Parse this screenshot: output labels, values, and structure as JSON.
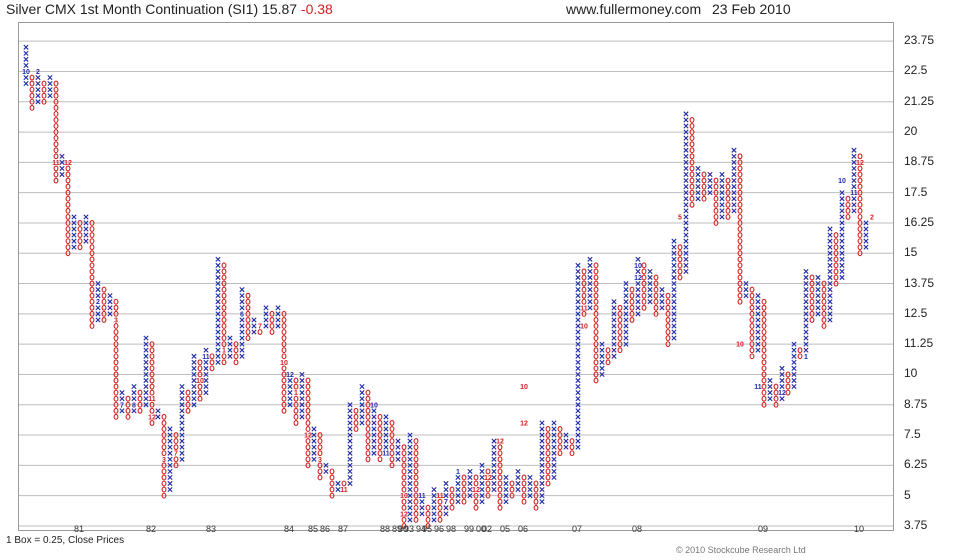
{
  "header": {
    "title": "Silver CMX 1st Month Continuation (SI1) 15.87",
    "change": "-0.38",
    "website": "www.fullermoney.com",
    "date": "23 Feb 2010"
  },
  "footer": {
    "box_note": "1 Box = 0.25, Close Prices",
    "copyright": "© 2010 Stockcube Research Ltd"
  },
  "colors": {
    "x_column": "#1e2aa8",
    "o_column": "#d42020",
    "grid": "#bdbdbd"
  },
  "chart_data": {
    "type": "point-and-figure",
    "title": "Silver CMX 1st Month Continuation (SI1) 15.87 -0.38",
    "box_size": 0.25,
    "price_basis": "Close Prices",
    "ylim": [
      3.5,
      24.5
    ],
    "y_ticks": [
      3.75,
      5,
      6.25,
      7.5,
      8.75,
      10,
      11.25,
      12.5,
      13.75,
      15,
      16.25,
      17.5,
      18.75,
      20,
      21.25,
      22.5,
      23.75
    ],
    "y_tick_labels": [
      "3.75",
      "5",
      "6.25",
      "7.5",
      "8.75",
      "10",
      "11.25",
      "12.5",
      "13.75",
      "15",
      "16.25",
      "17.5",
      "18.75",
      "20",
      "21.25",
      "22.5",
      "23.75"
    ],
    "grid": true,
    "x_tick_labels": [
      {
        "label": "81",
        "col": 9
      },
      {
        "label": "82",
        "col": 21
      },
      {
        "label": "83",
        "col": 31
      },
      {
        "label": "84",
        "col": 44
      },
      {
        "label": "85",
        "col": 48
      },
      {
        "label": "86",
        "col": 50
      },
      {
        "label": "87",
        "col": 53
      },
      {
        "label": "88",
        "col": 60
      },
      {
        "label": "89",
        "col": 62
      },
      {
        "label": "90",
        "col": 63
      },
      {
        "label": "93",
        "col": 64
      },
      {
        "label": "94",
        "col": 66
      },
      {
        "label": "95",
        "col": 67
      },
      {
        "label": "96",
        "col": 69
      },
      {
        "label": "98",
        "col": 71
      },
      {
        "label": "99",
        "col": 74
      },
      {
        "label": "00",
        "col": 76
      },
      {
        "label": "02",
        "col": 77
      },
      {
        "label": "05",
        "col": 80
      },
      {
        "label": "06",
        "col": 83
      },
      {
        "label": "07",
        "col": 92
      },
      {
        "label": "08",
        "col": 102
      },
      {
        "label": "09",
        "col": 123
      },
      {
        "label": "10",
        "col": 139
      }
    ],
    "columns": [
      {
        "type": "X",
        "low": 22.0,
        "high": 23.5
      },
      {
        "type": "O",
        "low": 21.0,
        "high": 22.25
      },
      {
        "type": "X",
        "low": 21.25,
        "high": 22.25
      },
      {
        "type": "O",
        "low": 21.25,
        "high": 22.0
      },
      {
        "type": "X",
        "low": 21.5,
        "high": 22.25
      },
      {
        "type": "O",
        "low": 18.0,
        "high": 22.0
      },
      {
        "type": "X",
        "low": 18.25,
        "high": 19.0
      },
      {
        "type": "O",
        "low": 15.0,
        "high": 18.75
      },
      {
        "type": "X",
        "low": 15.25,
        "high": 16.5
      },
      {
        "type": "O",
        "low": 15.25,
        "high": 16.25
      },
      {
        "type": "X",
        "low": 15.5,
        "high": 16.5
      },
      {
        "type": "O",
        "low": 12.0,
        "high": 16.25
      },
      {
        "type": "X",
        "low": 12.25,
        "high": 13.75
      },
      {
        "type": "O",
        "low": 12.25,
        "high": 13.5
      },
      {
        "type": "X",
        "low": 12.5,
        "high": 13.25
      },
      {
        "type": "O",
        "low": 8.25,
        "high": 13.0
      },
      {
        "type": "X",
        "low": 8.5,
        "high": 9.25
      },
      {
        "type": "O",
        "low": 8.25,
        "high": 9.0
      },
      {
        "type": "X",
        "low": 8.5,
        "high": 9.5
      },
      {
        "type": "O",
        "low": 8.5,
        "high": 9.25
      },
      {
        "type": "X",
        "low": 8.75,
        "high": 11.5
      },
      {
        "type": "O",
        "low": 8.0,
        "high": 11.25
      },
      {
        "type": "X",
        "low": 8.25,
        "high": 8.5
      },
      {
        "type": "O",
        "low": 5.0,
        "high": 8.25
      },
      {
        "type": "X",
        "low": 5.25,
        "high": 7.75
      },
      {
        "type": "O",
        "low": 6.25,
        "high": 7.5
      },
      {
        "type": "X",
        "low": 6.5,
        "high": 9.5
      },
      {
        "type": "O",
        "low": 8.5,
        "high": 9.25
      },
      {
        "type": "X",
        "low": 8.75,
        "high": 10.75
      },
      {
        "type": "O",
        "low": 9.0,
        "high": 10.5
      },
      {
        "type": "X",
        "low": 9.25,
        "high": 11.0
      },
      {
        "type": "O",
        "low": 10.25,
        "high": 10.75
      },
      {
        "type": "X",
        "low": 10.5,
        "high": 14.75
      },
      {
        "type": "O",
        "low": 10.5,
        "high": 14.5
      },
      {
        "type": "X",
        "low": 10.75,
        "high": 11.5
      },
      {
        "type": "O",
        "low": 10.5,
        "high": 11.25
      },
      {
        "type": "X",
        "low": 10.75,
        "high": 13.5
      },
      {
        "type": "O",
        "low": 11.5,
        "high": 13.25
      },
      {
        "type": "X",
        "low": 11.75,
        "high": 12.25
      },
      {
        "type": "O",
        "low": 11.75,
        "high": 12.0
      },
      {
        "type": "X",
        "low": 12.0,
        "high": 12.75
      },
      {
        "type": "O",
        "low": 11.75,
        "high": 12.5
      },
      {
        "type": "X",
        "low": 12.0,
        "high": 12.75
      },
      {
        "type": "O",
        "low": 8.5,
        "high": 12.5
      },
      {
        "type": "X",
        "low": 8.75,
        "high": 10.0
      },
      {
        "type": "O",
        "low": 8.0,
        "high": 9.75
      },
      {
        "type": "X",
        "low": 8.25,
        "high": 10.0
      },
      {
        "type": "O",
        "low": 6.25,
        "high": 9.75
      },
      {
        "type": "X",
        "low": 6.5,
        "high": 7.75
      },
      {
        "type": "O",
        "low": 5.75,
        "high": 7.5
      },
      {
        "type": "X",
        "low": 6.0,
        "high": 6.25
      },
      {
        "type": "O",
        "low": 5.0,
        "high": 6.0
      },
      {
        "type": "X",
        "low": 5.25,
        "high": 5.5
      },
      {
        "type": "O",
        "low": 5.25,
        "high": 5.5
      },
      {
        "type": "X",
        "low": 5.5,
        "high": 8.75
      },
      {
        "type": "O",
        "low": 7.75,
        "high": 8.5
      },
      {
        "type": "X",
        "low": 8.0,
        "high": 9.5
      },
      {
        "type": "O",
        "low": 6.5,
        "high": 9.25
      },
      {
        "type": "X",
        "low": 6.75,
        "high": 8.5
      },
      {
        "type": "O",
        "low": 6.5,
        "high": 8.25
      },
      {
        "type": "X",
        "low": 6.75,
        "high": 8.25
      },
      {
        "type": "O",
        "low": 6.25,
        "high": 8.0
      },
      {
        "type": "X",
        "low": 6.5,
        "high": 7.25
      },
      {
        "type": "O",
        "low": 3.75,
        "high": 7.0
      },
      {
        "type": "X",
        "low": 4.0,
        "high": 7.5
      },
      {
        "type": "O",
        "low": 4.0,
        "high": 7.25
      },
      {
        "type": "X",
        "low": 4.25,
        "high": 4.75
      },
      {
        "type": "O",
        "low": 3.75,
        "high": 4.5
      },
      {
        "type": "X",
        "low": 4.0,
        "high": 5.25
      },
      {
        "type": "O",
        "low": 4.0,
        "high": 5.0
      },
      {
        "type": "X",
        "low": 4.25,
        "high": 5.5
      },
      {
        "type": "O",
        "low": 4.5,
        "high": 5.25
      },
      {
        "type": "X",
        "low": 4.75,
        "high": 6.0
      },
      {
        "type": "O",
        "low": 4.75,
        "high": 5.75
      },
      {
        "type": "X",
        "low": 5.0,
        "high": 6.0
      },
      {
        "type": "O",
        "low": 4.5,
        "high": 5.75
      },
      {
        "type": "X",
        "low": 4.75,
        "high": 6.25
      },
      {
        "type": "O",
        "low": 5.0,
        "high": 6.0
      },
      {
        "type": "X",
        "low": 5.25,
        "high": 7.25
      },
      {
        "type": "O",
        "low": 4.5,
        "high": 7.0
      },
      {
        "type": "X",
        "low": 4.75,
        "high": 5.75
      },
      {
        "type": "O",
        "low": 5.0,
        "high": 5.5
      },
      {
        "type": "X",
        "low": 5.25,
        "high": 6.0
      },
      {
        "type": "O",
        "low": 4.75,
        "high": 5.75
      },
      {
        "type": "X",
        "low": 5.0,
        "high": 5.75
      },
      {
        "type": "O",
        "low": 4.5,
        "high": 5.5
      },
      {
        "type": "X",
        "low": 4.75,
        "high": 8.0
      },
      {
        "type": "O",
        "low": 5.5,
        "high": 7.75
      },
      {
        "type": "X",
        "low": 5.75,
        "high": 8.0
      },
      {
        "type": "O",
        "low": 6.75,
        "high": 7.75
      },
      {
        "type": "X",
        "low": 7.0,
        "high": 7.5
      },
      {
        "type": "O",
        "low": 6.75,
        "high": 7.25
      },
      {
        "type": "X",
        "low": 7.0,
        "high": 14.5
      },
      {
        "type": "O",
        "low": 12.5,
        "high": 14.25
      },
      {
        "type": "X",
        "low": 12.75,
        "high": 14.75
      },
      {
        "type": "O",
        "low": 9.75,
        "high": 14.5
      },
      {
        "type": "X",
        "low": 10.0,
        "high": 11.25
      },
      {
        "type": "O",
        "low": 10.5,
        "high": 11.0
      },
      {
        "type": "X",
        "low": 10.75,
        "high": 13.0
      },
      {
        "type": "O",
        "low": 11.0,
        "high": 12.75
      },
      {
        "type": "X",
        "low": 11.25,
        "high": 13.75
      },
      {
        "type": "O",
        "low": 12.25,
        "high": 13.5
      },
      {
        "type": "X",
        "low": 12.5,
        "high": 14.75
      },
      {
        "type": "O",
        "low": 12.75,
        "high": 14.5
      },
      {
        "type": "X",
        "low": 13.0,
        "high": 14.25
      },
      {
        "type": "O",
        "low": 12.5,
        "high": 14.0
      },
      {
        "type": "X",
        "low": 12.75,
        "high": 13.5
      },
      {
        "type": "O",
        "low": 11.25,
        "high": 13.25
      },
      {
        "type": "X",
        "low": 11.5,
        "high": 15.5
      },
      {
        "type": "O",
        "low": 14.0,
        "high": 15.25
      },
      {
        "type": "X",
        "low": 14.25,
        "high": 20.75
      },
      {
        "type": "O",
        "low": 17.0,
        "high": 20.5
      },
      {
        "type": "X",
        "low": 17.25,
        "high": 18.5
      },
      {
        "type": "O",
        "low": 17.25,
        "high": 18.25
      },
      {
        "type": "X",
        "low": 17.5,
        "high": 18.25
      },
      {
        "type": "O",
        "low": 16.25,
        "high": 18.0
      },
      {
        "type": "X",
        "low": 16.5,
        "high": 18.25
      },
      {
        "type": "O",
        "low": 16.5,
        "high": 18.0
      },
      {
        "type": "X",
        "low": 16.75,
        "high": 19.25
      },
      {
        "type": "O",
        "low": 13.0,
        "high": 19.0
      },
      {
        "type": "X",
        "low": 13.25,
        "high": 13.75
      },
      {
        "type": "O",
        "low": 10.75,
        "high": 13.5
      },
      {
        "type": "X",
        "low": 11.0,
        "high": 13.25
      },
      {
        "type": "O",
        "low": 8.75,
        "high": 13.0
      },
      {
        "type": "X",
        "low": 9.0,
        "high": 9.75
      },
      {
        "type": "O",
        "low": 8.75,
        "high": 9.5
      },
      {
        "type": "X",
        "low": 9.0,
        "high": 10.25
      },
      {
        "type": "O",
        "low": 9.25,
        "high": 10.0
      },
      {
        "type": "X",
        "low": 9.5,
        "high": 11.25
      },
      {
        "type": "O",
        "low": 10.75,
        "high": 11.0
      },
      {
        "type": "X",
        "low": 11.0,
        "high": 14.25
      },
      {
        "type": "O",
        "low": 12.25,
        "high": 14.0
      },
      {
        "type": "X",
        "low": 12.5,
        "high": 14.0
      },
      {
        "type": "O",
        "low": 12.0,
        "high": 13.75
      },
      {
        "type": "X",
        "low": 12.25,
        "high": 16.0
      },
      {
        "type": "O",
        "low": 13.75,
        "high": 15.75
      },
      {
        "type": "X",
        "low": 14.0,
        "high": 17.5
      },
      {
        "type": "O",
        "low": 16.5,
        "high": 17.25
      },
      {
        "type": "X",
        "low": 16.75,
        "high": 19.25
      },
      {
        "type": "O",
        "low": 15.0,
        "high": 19.0
      },
      {
        "type": "X",
        "low": 15.25,
        "high": 16.25
      }
    ],
    "month_markers": [
      {
        "col": 0,
        "price": 22.5,
        "text": "10"
      },
      {
        "col": 2,
        "price": 22.5,
        "text": "2"
      },
      {
        "col": 5,
        "price": 18.75,
        "text": "11"
      },
      {
        "col": 7,
        "price": 18.75,
        "text": "12"
      },
      {
        "col": 12,
        "price": 13.0,
        "text": "2"
      },
      {
        "col": 15,
        "price": 12.25,
        "text": "3"
      },
      {
        "col": 16,
        "price": 8.75,
        "text": "7"
      },
      {
        "col": 18,
        "price": 8.75,
        "text": "8"
      },
      {
        "col": 21,
        "price": 9.0,
        "text": "11"
      },
      {
        "col": 21,
        "price": 8.25,
        "text": "12"
      },
      {
        "col": 23,
        "price": 6.5,
        "text": "3"
      },
      {
        "col": 25,
        "price": 6.75,
        "text": "7"
      },
      {
        "col": 29,
        "price": 9.75,
        "text": "10"
      },
      {
        "col": 30,
        "price": 10.75,
        "text": "11"
      },
      {
        "col": 33,
        "price": 11.0,
        "text": "1"
      },
      {
        "col": 36,
        "price": 12.5,
        "text": "6"
      },
      {
        "col": 39,
        "price": 12.0,
        "text": "7"
      },
      {
        "col": 43,
        "price": 10.5,
        "text": "10"
      },
      {
        "col": 44,
        "price": 10.0,
        "text": "12"
      },
      {
        "col": 45,
        "price": 9.25,
        "text": "1"
      },
      {
        "col": 47,
        "price": 7.5,
        "text": "12"
      },
      {
        "col": 49,
        "price": 6.5,
        "text": "3"
      },
      {
        "col": 53,
        "price": 5.25,
        "text": "11"
      },
      {
        "col": 58,
        "price": 8.75,
        "text": "10"
      },
      {
        "col": 60,
        "price": 6.75,
        "text": "11"
      },
      {
        "col": 63,
        "price": 4.25,
        "text": "12"
      },
      {
        "col": 63,
        "price": 5.0,
        "text": "10"
      },
      {
        "col": 66,
        "price": 5.0,
        "text": "11"
      },
      {
        "col": 69,
        "price": 5.0,
        "text": "11"
      },
      {
        "col": 70,
        "price": 4.75,
        "text": "7"
      },
      {
        "col": 72,
        "price": 6.0,
        "text": "1"
      },
      {
        "col": 75,
        "price": 5.25,
        "text": "12"
      },
      {
        "col": 77,
        "price": 5.75,
        "text": "12"
      },
      {
        "col": 79,
        "price": 7.25,
        "text": "12"
      },
      {
        "col": 83,
        "price": 9.5,
        "text": "10"
      },
      {
        "col": 83,
        "price": 8.0,
        "text": "12"
      },
      {
        "col": 93,
        "price": 12.75,
        "text": "11"
      },
      {
        "col": 93,
        "price": 12.0,
        "text": "10"
      },
      {
        "col": 102,
        "price": 14.5,
        "text": "10"
      },
      {
        "col": 102,
        "price": 14.0,
        "text": "12"
      },
      {
        "col": 109,
        "price": 16.5,
        "text": "5"
      },
      {
        "col": 119,
        "price": 11.25,
        "text": "10"
      },
      {
        "col": 122,
        "price": 9.5,
        "text": "11"
      },
      {
        "col": 126,
        "price": 9.25,
        "text": "12"
      },
      {
        "col": 130,
        "price": 10.75,
        "text": "1"
      },
      {
        "col": 136,
        "price": 18.0,
        "text": "10"
      },
      {
        "col": 138,
        "price": 17.5,
        "text": "11"
      },
      {
        "col": 139,
        "price": 18.75,
        "text": "12"
      },
      {
        "col": 141,
        "price": 16.5,
        "text": "2"
      }
    ]
  }
}
